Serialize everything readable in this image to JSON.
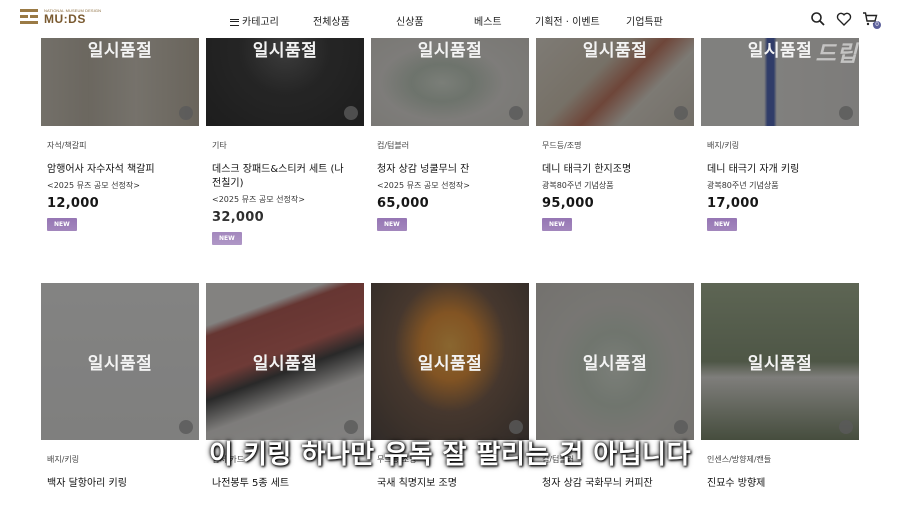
{
  "brand": {
    "small_text": "NATIONAL MUSEUM DESIGN",
    "name": "MU:DS"
  },
  "nav": {
    "category": "카테고리",
    "all": "전체상품",
    "new": "신상품",
    "best": "베스트",
    "events": "기획전 · 이벤트",
    "corporate": "기업특판"
  },
  "header_icons": [
    "search-icon",
    "heart-icon",
    "cart-icon"
  ],
  "cart_count": "0",
  "soldout_label": "일시품절",
  "products_row1": [
    {
      "category": "자석/책갈피",
      "name": "암행어사 자수자석 책갈피",
      "sub": "<2025 뮤즈 공모 선정작>",
      "price": "12,000",
      "badge": "NEW"
    },
    {
      "category": "기타",
      "name": "데스크 장패드&스티커 세트 (나전칠기)",
      "sub": "<2025 뮤즈 공모 선정작>",
      "price": "32,000",
      "badge": "NEW"
    },
    {
      "category": "컵/텀블러",
      "name": "청자 상감 넝쿨무늬 잔",
      "sub": "<2025 뮤즈 공모 선정작>",
      "price": "65,000",
      "badge": "NEW"
    },
    {
      "category": "무드등/조명",
      "name": "데니 태극기 한지조명",
      "sub": "광복80주년 기념상품",
      "price": "95,000",
      "badge": "NEW"
    },
    {
      "category": "배지/키링",
      "name": "데니 태극기 자개 키링",
      "sub": "광복80주년 기념상품",
      "price": "17,000",
      "badge": "NEW"
    }
  ],
  "products_row2": [
    {
      "category": "배지/키링",
      "name": "백자 달항아리 키링"
    },
    {
      "category": "엽서/카드",
      "name": "나전봉투 5종 세트"
    },
    {
      "category": "무드등/조명",
      "name": "국새 칙명지보 조명"
    },
    {
      "category": "컵/텀블러",
      "name": "청자 상감 국화무늬 커피잔"
    },
    {
      "category": "인센스/방향제/캔들",
      "name": "진묘수 방향제"
    }
  ],
  "caption": "이 키링 하나만 유독 잘 팔리는 건 아닙니다",
  "watermark": "드립",
  "colors": {
    "badge": "#8560a8",
    "logo": "#7a5a30",
    "cart_badge": "#5b5f9a"
  }
}
